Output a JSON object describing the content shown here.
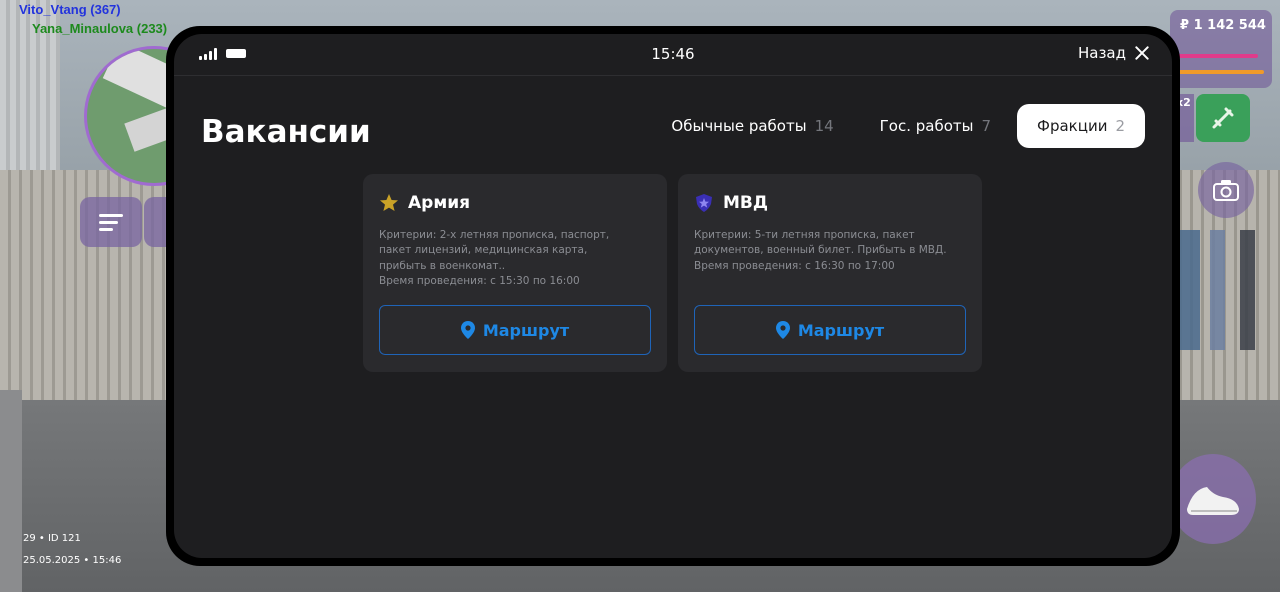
{
  "hud": {
    "player_names": [
      "Vito_Vtang (367)",
      "Yana_Minaulova (233)"
    ],
    "money": "₽ 1 142 544",
    "multiplier": "x2",
    "info_line": "29 • ID 121",
    "datetime": "25.05.2025 • 15:46"
  },
  "phone": {
    "status": {
      "time": "15:46"
    },
    "back_label": "Назад",
    "title": "Вакансии",
    "tabs": [
      {
        "label": "Обычные работы",
        "count": "14",
        "active": false
      },
      {
        "label": "Гос. работы",
        "count": "7",
        "active": false
      },
      {
        "label": "Фракции",
        "count": "2",
        "active": true
      }
    ],
    "vacancies": [
      {
        "title": "Армия",
        "icon": "star-icon",
        "description": [
          "Критерии: 2-х летняя прописка, паспорт,",
          "пакет лицензий, медицинская карта,",
          "прибыть в военкомат..",
          "Время проведения: с 15:30 по 16:00"
        ],
        "button_label": "Маршрут"
      },
      {
        "title": "МВД",
        "icon": "police-shield-icon",
        "description": [
          "Критерии: 5-ти летняя прописка, пакет",
          "документов, военный билет. Прибыть в МВД.",
          "Время проведения: с 16:30 по 17:00"
        ],
        "button_label": "Маршрут"
      }
    ]
  },
  "colors": {
    "accent_blue": "#1e88e5",
    "panel_bg": "#1e1e20",
    "card_bg": "#2a2a2d",
    "star_gold": "#c9a227",
    "shield_purple": "#5a4ad1"
  }
}
